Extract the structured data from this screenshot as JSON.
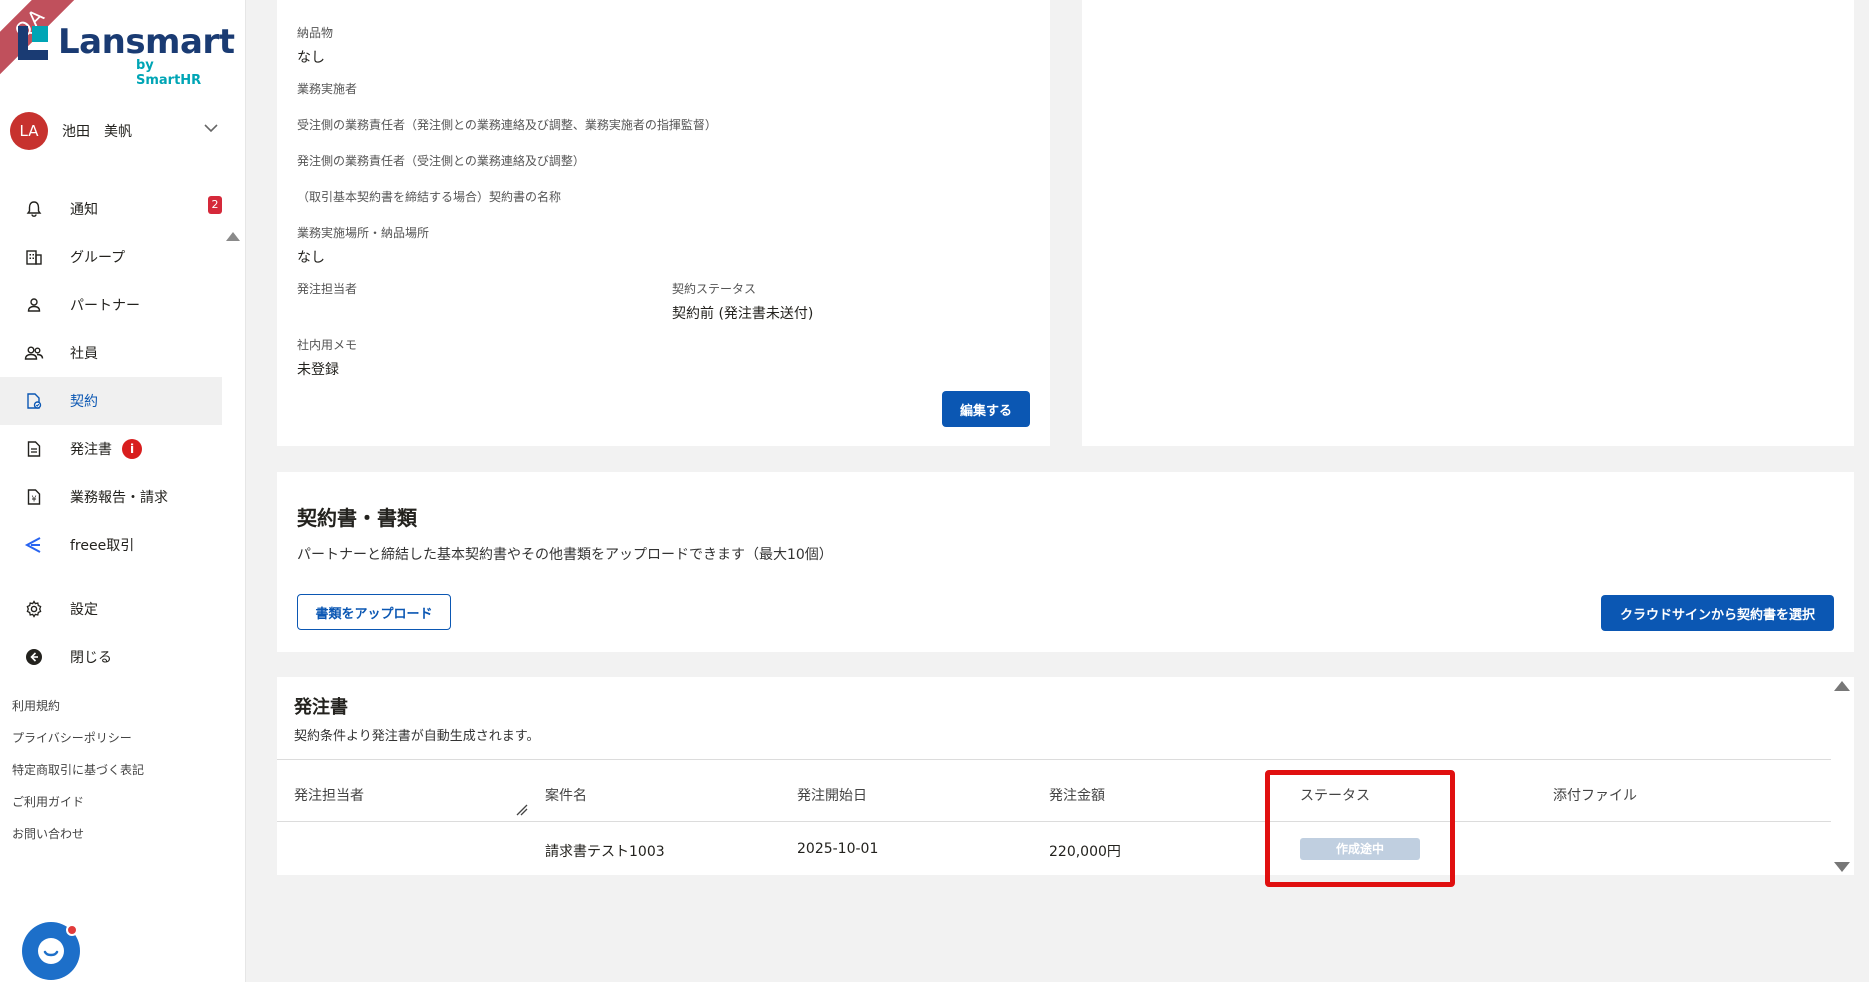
{
  "badge": {
    "qa": "QA"
  },
  "brand": {
    "name": "Lansmart",
    "sub": "by SmartHR"
  },
  "user": {
    "initials": "LA",
    "name": "池田　美帆"
  },
  "nav": {
    "notifications": {
      "label": "通知",
      "badge": "2"
    },
    "groups": {
      "label": "グループ"
    },
    "partners": {
      "label": "パートナー"
    },
    "employees": {
      "label": "社員"
    },
    "contracts": {
      "label": "契約"
    },
    "orders": {
      "label": "発注書",
      "alert": "i"
    },
    "reports": {
      "label": "業務報告・請求"
    },
    "freee": {
      "label": "freee取引"
    },
    "settings": {
      "label": "設定"
    },
    "close": {
      "label": "閉じる"
    }
  },
  "footer": {
    "terms": "利用規約",
    "privacy": "プライバシーポリシー",
    "commerce": "特定商取引に基づく表記",
    "guide": "ご利用ガイド",
    "contact": "お問い合わせ"
  },
  "details": {
    "deliverables": {
      "label": "納品物",
      "value": "なし"
    },
    "executors": {
      "label": "業務実施者"
    },
    "recipient_manager": {
      "label": "受注側の業務責任者（発注側との業務連絡及び調整、業務実施者の指揮監督）"
    },
    "orderer_manager": {
      "label": "発注側の業務責任者（受注側との業務連絡及び調整）"
    },
    "master_contract": {
      "label": "（取引基本契約書を締結する場合）契約書の名称"
    },
    "place": {
      "label": "業務実施場所・納品場所",
      "value": "なし"
    },
    "person_in_charge": {
      "label": "発注担当者"
    },
    "contract_status": {
      "label": "契約ステータス",
      "value": "契約前 (発注書未送付)"
    },
    "memo": {
      "label": "社内用メモ",
      "value": "未登録"
    },
    "edit_button": "編集する"
  },
  "documents": {
    "title": "契約書・書類",
    "description": "パートナーと締結した基本契約書やその他書類をアップロードできます（最大10個）",
    "upload_button": "書類をアップロード",
    "cloudsign_button": "クラウドサインから契約書を選択"
  },
  "purchase_orders": {
    "title": "発注書",
    "description": "契約条件より発注書が自動生成されます。",
    "columns": [
      "発注担当者",
      "案件名",
      "発注開始日",
      "発注金額",
      "ステータス",
      "添付ファイル"
    ],
    "rows": [
      {
        "person": "",
        "project": "請求書テスト1003",
        "start_date": "2025-10-01",
        "amount": "220,000円",
        "status": "作成途中",
        "attachment": ""
      }
    ]
  },
  "colors": {
    "primary": "#0b57b3",
    "danger": "#d5293a",
    "highlight": "#e01010",
    "status_chip": "#c0cfe0"
  }
}
